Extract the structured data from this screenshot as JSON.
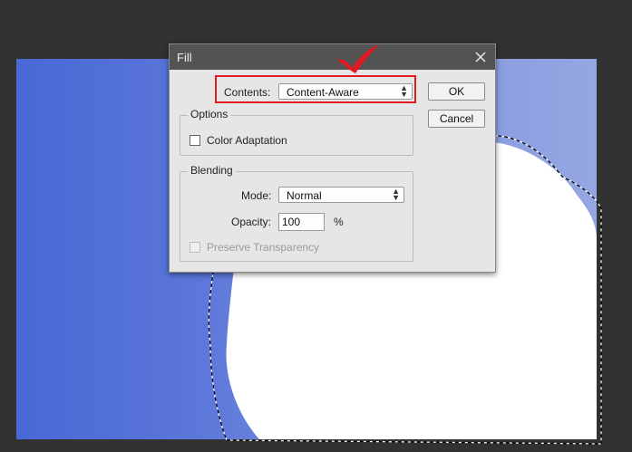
{
  "dialog": {
    "title": "Fill",
    "contents_label": "Contents:",
    "contents_value": "Content-Aware",
    "ok_label": "OK",
    "cancel_label": "Cancel",
    "options_group": {
      "label": "Options",
      "color_adaptation_label": "Color Adaptation",
      "color_adaptation_checked": false
    },
    "blending_group": {
      "label": "Blending",
      "mode_label": "Mode:",
      "mode_value": "Normal",
      "opacity_label": "Opacity:",
      "opacity_value": "100",
      "opacity_unit": "%",
      "preserve_transparency_label": "Preserve Transparency",
      "preserve_transparency_enabled": false
    }
  },
  "annotations": {
    "highlight_color": "#e01b24",
    "checkmark_color": "#e01b24"
  },
  "icons": {
    "close": "close-icon",
    "dropdown": "updown-arrows-icon",
    "checkmark": "checkmark-icon"
  },
  "colors": {
    "workspace": "#323232",
    "image_blue_left": "#4a68d6",
    "image_blue_right": "#95a6e3",
    "dialog_bg": "#e6e6e6",
    "title_bar": "#535353"
  }
}
